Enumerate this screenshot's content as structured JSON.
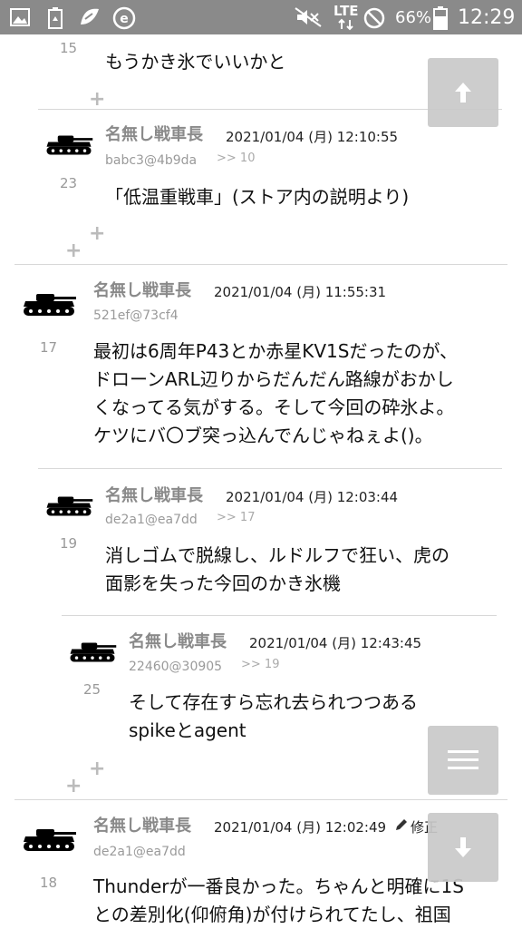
{
  "status_bar": {
    "battery_pct": "66%",
    "time": "12:29",
    "network": "LTE",
    "icons": [
      "gallery-icon",
      "battery-saver-icon",
      "notification-app-icon",
      "e-app-icon",
      "mute-icon",
      "lte-signal-icon",
      "do-not-disturb-icon",
      "battery-icon"
    ]
  },
  "posts": [
    {
      "number": "15",
      "lines": [
        "もうかき氷でいいかと"
      ]
    },
    {
      "number": "23",
      "name": "名無し戦車長",
      "date": "2021/01/04 (月) 12:10:55",
      "uid": "babc3@4b9da",
      "reply_to": ">> 10",
      "lines": [
        "「低温重戦車」(ストア内の説明より)"
      ]
    },
    {
      "number": "17",
      "name": "名無し戦車長",
      "date": "2021/01/04 (月) 11:55:31",
      "uid": "521ef@73cf4",
      "lines": [
        "最初は6周年P43とか赤星KV1Sだったのが、",
        "ドローンARL辺りからだんだん路線がおかし",
        "くなってる気がする。そして今回の砕氷よ。",
        "ケツにバ〇ブ突っ込んでんじゃねぇよ()。"
      ]
    },
    {
      "number": "19",
      "name": "名無し戦車長",
      "date": "2021/01/04 (月) 12:03:44",
      "uid": "de2a1@ea7dd",
      "reply_to": ">> 17",
      "lines": [
        "消しゴムで脱線し、ルドルフで狂い、虎の",
        "面影を失った今回のかき氷機"
      ]
    },
    {
      "number": "25",
      "name": "名無し戦車長",
      "date": "2021/01/04 (月) 12:43:45",
      "uid": "22460@30905",
      "reply_to": ">> 19",
      "lines": [
        "そして存在すら忘れ去られつつある",
        "spikeとagent"
      ]
    },
    {
      "number": "18",
      "name": "名無し戦車長",
      "date": "2021/01/04 (月) 12:02:49",
      "edited_label": "修正",
      "uid": "de2a1@ea7dd",
      "lines": [
        "Thunderが一番良かった。ちゃんと明確に1S",
        "との差別化(仰俯角)が付けられてたし、祖国"
      ]
    }
  ],
  "plus_label": "+",
  "buttons": {
    "scroll_top": "arrow-up-icon",
    "menu": "menu-icon",
    "scroll_bottom": "arrow-down-icon"
  }
}
